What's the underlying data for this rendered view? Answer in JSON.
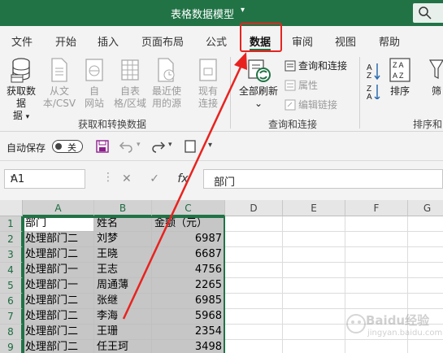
{
  "titlebar": {
    "title": "表格数据模型",
    "caret": "▾"
  },
  "tabs": [
    "文件",
    "开始",
    "插入",
    "页面布局",
    "公式",
    "数据",
    "审阅",
    "视图",
    "帮助"
  ],
  "active_tab": "数据",
  "ribbon": {
    "get_data": "获取数据",
    "get_data_arrow": "▾",
    "from_text": "从文",
    "from_text2": "本/CSV",
    "from_web": "自",
    "from_web2": "网站",
    "from_table": "自表",
    "from_table2": "格/区域",
    "recent": "最近使",
    "recent2": "用的源",
    "existing": "现有",
    "existing2": "连接",
    "group1_label": "获取和转换数据",
    "refresh_all": "全部刷新",
    "refresh_arrow": "⌄",
    "queries_connections": "查询和连接",
    "properties": "属性",
    "edit_links": "编辑链接",
    "group2_label": "查询和连接",
    "sort": "排序",
    "filter": "筛",
    "group3_label": "排序和"
  },
  "qat": {
    "autosave_label": "自动保存",
    "toggle_state": "关"
  },
  "formula_bar": {
    "name_box": "A1",
    "fx": "fx",
    "content": "部门"
  },
  "columns": [
    "A",
    "B",
    "C",
    "D",
    "E",
    "F",
    "G"
  ],
  "rows": [
    "1",
    "2",
    "3",
    "4",
    "5",
    "6",
    "7",
    "8",
    "9"
  ],
  "table": {
    "headers": [
      "部门",
      "姓名",
      "金额（元）"
    ],
    "data": [
      [
        "处理部门二",
        "刘梦",
        "6987"
      ],
      [
        "处理部门二",
        "王晓",
        "6687"
      ],
      [
        "处理部门一",
        "王志",
        "4756"
      ],
      [
        "处理部门一",
        "周通薄",
        "2265"
      ],
      [
        "处理部门二",
        "张继",
        "6985"
      ],
      [
        "处理部门二",
        "李海",
        "5968"
      ],
      [
        "处理部门二",
        "王珊",
        "2354"
      ],
      [
        "处理部门二",
        "任王珂",
        "3498"
      ]
    ]
  },
  "watermark": {
    "text": "Baidu经验",
    "url": "jingyan.baidu.com"
  },
  "colors": {
    "excel_green": "#217346",
    "annotation_red": "#e8231f"
  }
}
